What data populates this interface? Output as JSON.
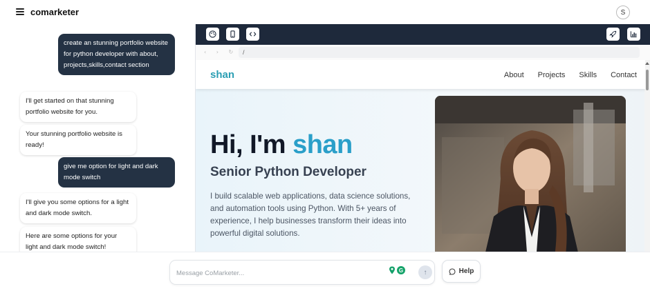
{
  "app": {
    "title": "comarketer",
    "avatar_initial": "S"
  },
  "chat": {
    "messages": [
      {
        "role": "user",
        "text": "create an stunning portfolio website for python developer with about, projects,skills,contact section"
      },
      {
        "role": "assistant",
        "text": "I'll get started on that stunning portfolio website for you."
      },
      {
        "role": "assistant",
        "text": "Your stunning portfolio website is ready!"
      },
      {
        "role": "user",
        "text": "give me option for light and dark mode switch"
      },
      {
        "role": "assistant",
        "text": "I'll give you some options for a light and dark mode switch."
      },
      {
        "role": "assistant",
        "text": "Here are some options for your light and dark mode switch!"
      }
    ]
  },
  "preview": {
    "toolbar": {
      "left": [
        "palette-icon",
        "mobile-icon",
        "code-icon"
      ],
      "right": [
        "rocket-icon",
        "chart-icon"
      ]
    },
    "address": {
      "path": "/"
    },
    "site": {
      "brand": "shan",
      "nav": [
        "About",
        "Projects",
        "Skills",
        "Contact"
      ],
      "hero": {
        "greeting": "Hi, I'm ",
        "name": "shan",
        "subtitle": "Senior Python Developer",
        "description": "I build scalable web applications, data science solutions, and automation tools using Python. With 5+ years of experience, I help businesses transform their ideas into powerful digital solutions."
      }
    }
  },
  "composer": {
    "placeholder": "Message CoMarketer...",
    "help_label": "Help"
  },
  "colors": {
    "accent": "#2a9fc9",
    "user_bubble": "#243244",
    "toolbar": "#1e293b"
  }
}
